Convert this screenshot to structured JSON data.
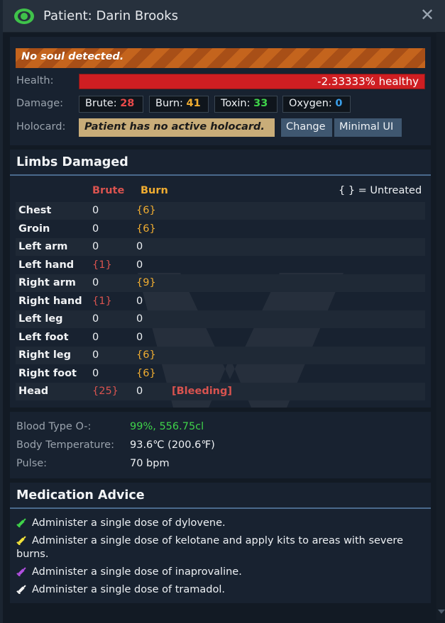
{
  "window": {
    "title": "Patient: Darin Brooks",
    "close_symbol": "✕",
    "title_icon": "eye-icon",
    "close_icon": "close-icon"
  },
  "status": {
    "alert": "No soul detected.",
    "health_label": "Health:",
    "health_value": "-2.33333% healthy",
    "damage_label": "Damage:",
    "damage": [
      {
        "name": "Brute:",
        "value": "28",
        "color": "#e84a4a"
      },
      {
        "name": "Burn:",
        "value": "41",
        "color": "#f0ad31"
      },
      {
        "name": "Toxin:",
        "value": "33",
        "color": "#3fd34a"
      },
      {
        "name": "Oxygen:",
        "value": "0",
        "color": "#3a9ee8"
      }
    ],
    "holocard_label": "Holocard:",
    "holocard_value": "Patient has no active holocard.",
    "change_button": "Change",
    "minimal_button": "Minimal UI"
  },
  "limbs": {
    "title": "Limbs Damaged",
    "col_brute": "Brute",
    "col_burn": "Burn",
    "legend": "{ } = Untreated",
    "rows": [
      {
        "name": "Chest",
        "brute": "0",
        "burn": "{6}",
        "extra": ""
      },
      {
        "name": "Groin",
        "brute": "0",
        "burn": "{6}",
        "extra": ""
      },
      {
        "name": "Left arm",
        "brute": "0",
        "burn": "0",
        "extra": ""
      },
      {
        "name": "Left hand",
        "brute": "{1}",
        "burn": "0",
        "extra": ""
      },
      {
        "name": "Right arm",
        "brute": "0",
        "burn": "{9}",
        "extra": ""
      },
      {
        "name": "Right hand",
        "brute": "{1}",
        "burn": "0",
        "extra": ""
      },
      {
        "name": "Left leg",
        "brute": "0",
        "burn": "0",
        "extra": ""
      },
      {
        "name": "Left foot",
        "brute": "0",
        "burn": "0",
        "extra": ""
      },
      {
        "name": "Right leg",
        "brute": "0",
        "burn": "{6}",
        "extra": ""
      },
      {
        "name": "Right foot",
        "brute": "0",
        "burn": "{6}",
        "extra": ""
      },
      {
        "name": "Head",
        "brute": "{25}",
        "burn": "0",
        "extra": "[Bleeding]"
      }
    ]
  },
  "vitals": {
    "blood_label": "Blood Type O-:",
    "blood_value": "99%, 556.75cl",
    "temp_label": "Body Temperature:",
    "temp_value": "93.6℃ (200.6℉)",
    "pulse_label": "Pulse:",
    "pulse_value": "70 bpm"
  },
  "medication": {
    "title": "Medication Advice",
    "items": [
      {
        "text": "Administer a single dose of dylovene.",
        "icon": "syringe-icon",
        "color": "#3fd34a"
      },
      {
        "text": "Administer a single dose of kelotane and apply kits to areas with severe burns.",
        "icon": "syringe-icon",
        "color": "#f2e23a"
      },
      {
        "text": "Administer a single dose of inaprovaline.",
        "icon": "syringe-icon",
        "color": "#b14fe0"
      },
      {
        "text": "Administer a single dose of tramadol.",
        "icon": "syringe-icon",
        "color": "#f4f4f4"
      }
    ]
  }
}
